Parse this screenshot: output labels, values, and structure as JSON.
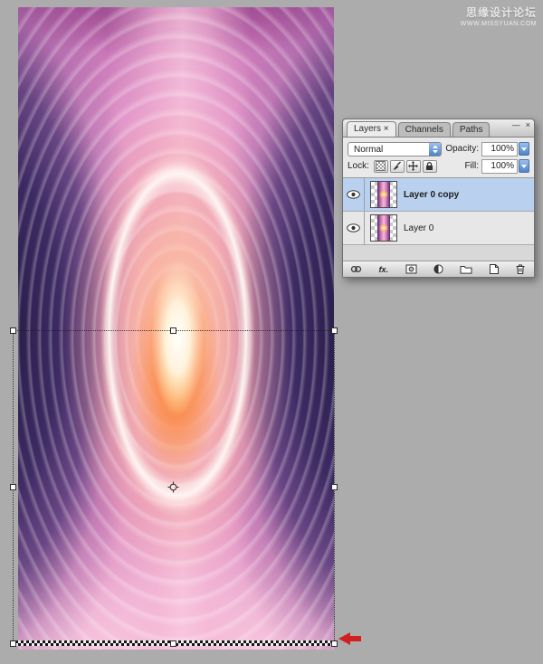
{
  "colors": {
    "workspace_background": "#acacac",
    "selected_layer_blue": "#b9d0ee",
    "stepper_blue": "#4d82c8",
    "arrow_red": "#d22020",
    "panel_background": "#ececec"
  },
  "watermark": {
    "line1": "思缘设计论坛",
    "line2": "WWW.MISSYUAN.COM"
  },
  "panel": {
    "minimize_label": "—",
    "close_label": "×",
    "tabs": [
      {
        "label": "Layers ×"
      },
      {
        "label": "Channels"
      },
      {
        "label": "Paths"
      }
    ],
    "blend_mode": "Normal",
    "opacity_label": "Opacity:",
    "opacity_value": "100%",
    "lock_label": "Lock:",
    "fill_label": "Fill:",
    "fill_value": "100%",
    "fx_label": "fx.",
    "layers": [
      {
        "name": "Layer 0 copy"
      },
      {
        "name": "Layer 0"
      }
    ]
  }
}
